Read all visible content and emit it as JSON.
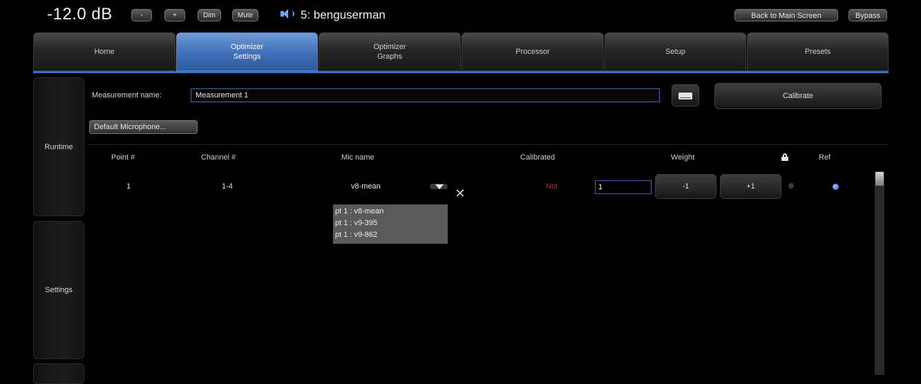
{
  "topbar": {
    "volume": "-12.0 dB",
    "minus_label": "-",
    "plus_label": "+",
    "dim_label": "Dim",
    "mute_label": "Mute",
    "preset_name": "5: benguserman",
    "back_label": "Back to Main Screen",
    "bypass_label": "Bypass"
  },
  "tabs": [
    {
      "label": "Home"
    },
    {
      "label": "Optimizer\nSettings",
      "active": true
    },
    {
      "label": "Optimizer\nGraphs"
    },
    {
      "label": "Processor"
    },
    {
      "label": "Setup"
    },
    {
      "label": "Presets"
    }
  ],
  "sidebar": {
    "items": [
      {
        "label": "Runtime"
      },
      {
        "label": "Settings"
      }
    ]
  },
  "measurement": {
    "name_label": "Measurement name:",
    "name_value": "Measurement 1",
    "calibrate_label": "Calibrate",
    "default_mic_label": "Default Microphone..."
  },
  "table": {
    "headers": {
      "point": "Point #",
      "channel": "Channel #",
      "mic": "Mic name",
      "calibrated": "Calibrated",
      "weight": "Weight",
      "ref": "Ref"
    },
    "row": {
      "point": "1",
      "channel": "1-4",
      "mic": "v8-mean",
      "calibrated": "Not",
      "weight": "1",
      "minus_label": "-1",
      "plus_label": "+1"
    },
    "mic_options": [
      "pt 1 : v8-mean",
      "pt 1 : v9-395",
      "pt 1 : v9-862"
    ]
  },
  "colors": {
    "accent": "#3c6fc4",
    "not_calibrated": "#b12b2b"
  }
}
